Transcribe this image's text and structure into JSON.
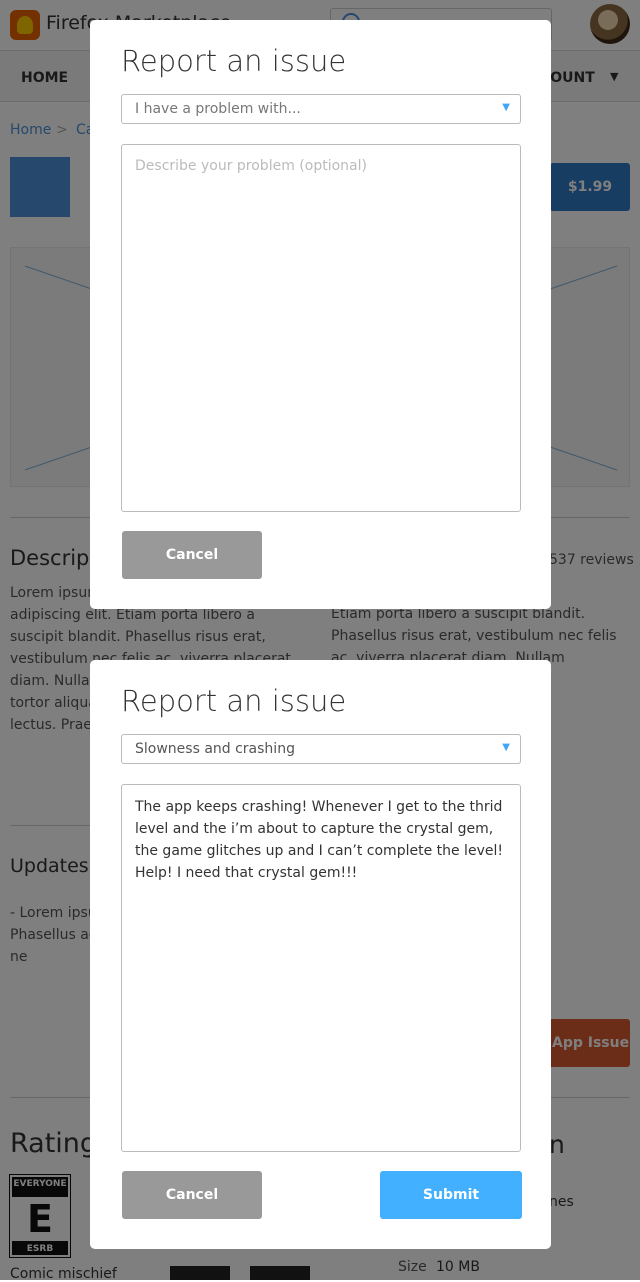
{
  "colors": {
    "accent": "#42b0ff",
    "link": "#4a90d9",
    "issue_button": "#d65a31",
    "cancel_button": "#999999"
  },
  "header": {
    "brand": "Firefox Marketplace",
    "search_icon": "search-icon"
  },
  "nav": {
    "home": "HOME",
    "account": "COUNT",
    "account_caret": "▼"
  },
  "breadcrumb": {
    "home": "Home",
    "separator": ">",
    "category": "Ca"
  },
  "app": {
    "price": "$1.99",
    "app_issue_button": "App Issue"
  },
  "description": {
    "title": "Descripti",
    "left_text": "Lorem ipsum dolor sit amet, consectetur adipiscing elit. Etiam porta libero a suscipit blandit. Phasellus risus erat, vestibulum nec felis ac, viverra placerat diam. Nullam consequat odio semper nec tortor aliquam eu neque ve lorem ultric lectus. Prae",
    "right_text": "Etiam porta libero a suscipit blandit. Phasellus risus erat, vestibulum nec felis ac, viverra placerat diam. Nullam consequat semper nec.",
    "reviews": "537 reviews"
  },
  "updates": {
    "title": "Updates",
    "text": "- Lorem ipsum adipiscing - Etiam port Phasellus ac, viverra consequat semper ne"
  },
  "ratings": {
    "title": "Rating",
    "esrb_top": "EVERYONE",
    "esrb_letter": "E",
    "esrb_bottom": "ESRB",
    "descriptor": "Comic mischief",
    "right_title": "n",
    "right_line": "nes",
    "size_label": "Size",
    "size_value": "10 MB"
  },
  "dialogs": [
    {
      "title": "Report an issue",
      "select_value": "I have a problem with...",
      "textarea_placeholder": "Describe your problem (optional)",
      "textarea_value": "",
      "cancel": "Cancel"
    },
    {
      "title": "Report an issue",
      "select_value": "Slowness and crashing",
      "textarea_placeholder": "",
      "textarea_value": "The app keeps crashing! Whenever I get to the thrid level and the i’m about to capture the crystal gem, the game glitches up and I can’t complete the level! Help! I need that crystal gem!!!",
      "cancel": "Cancel",
      "submit": "Submit"
    }
  ]
}
